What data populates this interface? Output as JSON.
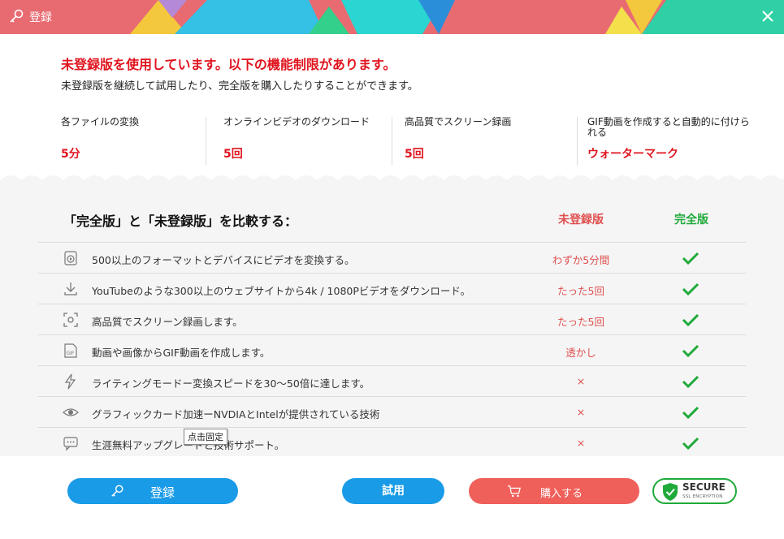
{
  "window": {
    "title": "登録"
  },
  "notice": {
    "headline": "未登録版を使用しています。以下の機能制限があります。",
    "subline": "未登録版を継続して試用したり、完全版を購入したりすることができます。"
  },
  "limits": [
    {
      "label": "各ファイルの変換",
      "value": "5分"
    },
    {
      "label": "オンラインビデオのダウンロード",
      "value": "5回"
    },
    {
      "label": "高品質でスクリーン録画",
      "value": "5回"
    },
    {
      "label": "GIF動画を作成すると自動的に付けられる",
      "value": "ウォーターマーク"
    }
  ],
  "comparison": {
    "title": "「完全版」と「未登録版」を比較する：",
    "col_free": "未登録版",
    "col_full": "完全版",
    "rows": [
      {
        "icon": "video-convert-icon",
        "text": "500以上のフォーマットとデバイスにビデオを変換する。",
        "free": "わずか5分間",
        "full": "check"
      },
      {
        "icon": "download-icon",
        "text": "YouTubeのような300以上のウェブサイトから4k / 1080Pビデオをダウンロード。",
        "free": "たった5回",
        "full": "check"
      },
      {
        "icon": "screen-record-icon",
        "text": "高品質でスクリーン録画します。",
        "free": "たった5回",
        "full": "check"
      },
      {
        "icon": "gif-icon",
        "text": "動画や画像からGIF動画を作成します。",
        "free": "透かし",
        "full": "check"
      },
      {
        "icon": "lightning-icon",
        "text": "ライティングモードー変換スピードを30〜50倍に達します。",
        "free": "×",
        "full": "check"
      },
      {
        "icon": "gpu-icon",
        "text": "グラフィックカード加速ーNVDIAとIntelが提供されている技術",
        "free": "×",
        "full": "check"
      },
      {
        "icon": "support-chat-icon",
        "text": "生涯無料アップグレードと技術サポート。",
        "free": "×",
        "full": "check"
      }
    ]
  },
  "tooltip": "点击固定",
  "buttons": {
    "register": "登録",
    "trial": "試用",
    "buy": "購入する"
  },
  "badge": {
    "main": "SECURE",
    "sub": "SSL ENCRYPTION"
  },
  "colors": {
    "red": "#e0141e",
    "green": "#1faa3a",
    "blue": "#1a9be8",
    "coral": "#f0605a"
  }
}
